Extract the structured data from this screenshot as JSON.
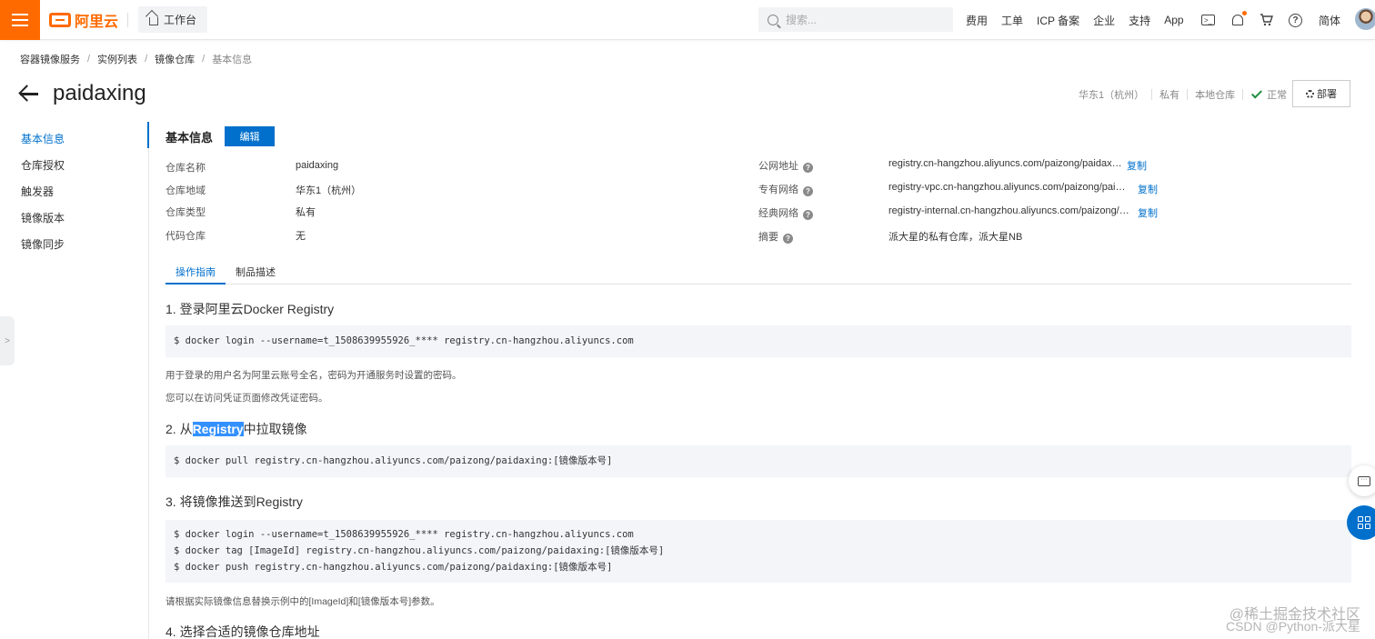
{
  "topbar": {
    "logo_text": "阿里云",
    "workbench_label": "工作台",
    "search_placeholder": "搜索...",
    "nav_links": [
      "费用",
      "工单",
      "ICP 备案",
      "企业",
      "支持",
      "App"
    ],
    "icons": [
      "terminal-icon",
      "bell-icon",
      "cart-icon",
      "help-icon"
    ],
    "lang_label": "简体",
    "accent_color": "#ff6a00"
  },
  "breadcrumb": [
    "容器镜像服务",
    "实例列表",
    "镜像仓库",
    "基本信息"
  ],
  "header": {
    "title": "paidaxing",
    "region": "华东1（杭州）",
    "visibility": "私有",
    "repo_kind": "本地仓库",
    "status": "正常",
    "deploy_label": "部署"
  },
  "leftnav": {
    "items": [
      "基本信息",
      "仓库授权",
      "触发器",
      "镜像版本",
      "镜像同步"
    ],
    "active_index": 0
  },
  "basic_info": {
    "section_title": "基本信息",
    "edit_label": "编辑",
    "left_fields": [
      {
        "label": "仓库名称",
        "value": "paidaxing"
      },
      {
        "label": "仓库地域",
        "value": "华东1（杭州）"
      },
      {
        "label": "仓库类型",
        "value": "私有"
      },
      {
        "label": "代码仓库",
        "value": "无"
      }
    ],
    "right_fields": [
      {
        "label": "公网地址",
        "value": "registry.cn-hangzhou.aliyuncs.com/paizong/paidaxing",
        "copy": "复制"
      },
      {
        "label": "专有网络",
        "value": "registry-vpc.cn-hangzhou.aliyuncs.com/paizong/paida...",
        "copy": "复制"
      },
      {
        "label": "经典网络",
        "value": "registry-internal.cn-hangzhou.aliyuncs.com/paizong/p...",
        "copy": "复制"
      },
      {
        "label": "摘要",
        "value": "派大星的私有仓库，派大星NB"
      }
    ]
  },
  "tabs": [
    "操作指南",
    "制品描述"
  ],
  "guide": {
    "step1": {
      "title": "1. 登录阿里云Docker Registry",
      "code": [
        "$ docker login --username=t_1508639955926_**** registry.cn-hangzhou.aliyuncs.com"
      ],
      "notes": [
        "用于登录的用户名为阿里云账号全名，密码为开通服务时设置的密码。",
        "您可以在访问凭证页面修改凭证密码。"
      ]
    },
    "step2": {
      "title_pre": "2. 从",
      "title_hl": "Registry",
      "title_post": "中拉取镜像",
      "code": [
        "$ docker pull registry.cn-hangzhou.aliyuncs.com/paizong/paidaxing:[镜像版本号]"
      ]
    },
    "step3": {
      "title": "3. 将镜像推送到Registry",
      "code": [
        "$ docker login --username=t_1508639955926_**** registry.cn-hangzhou.aliyuncs.com",
        "$ docker tag [ImageId] registry.cn-hangzhou.aliyuncs.com/paizong/paidaxing:[镜像版本号]",
        "$ docker push registry.cn-hangzhou.aliyuncs.com/paizong/paidaxing:[镜像版本号]"
      ],
      "note": "请根据实际镜像信息替换示例中的[ImageId]和[镜像版本号]参数。"
    },
    "step4": {
      "title": "4. 选择合适的镜像仓库地址"
    }
  },
  "watermark": {
    "line1": "@稀土掘金技术社区",
    "line2": "CSDN @Python-派大星"
  }
}
